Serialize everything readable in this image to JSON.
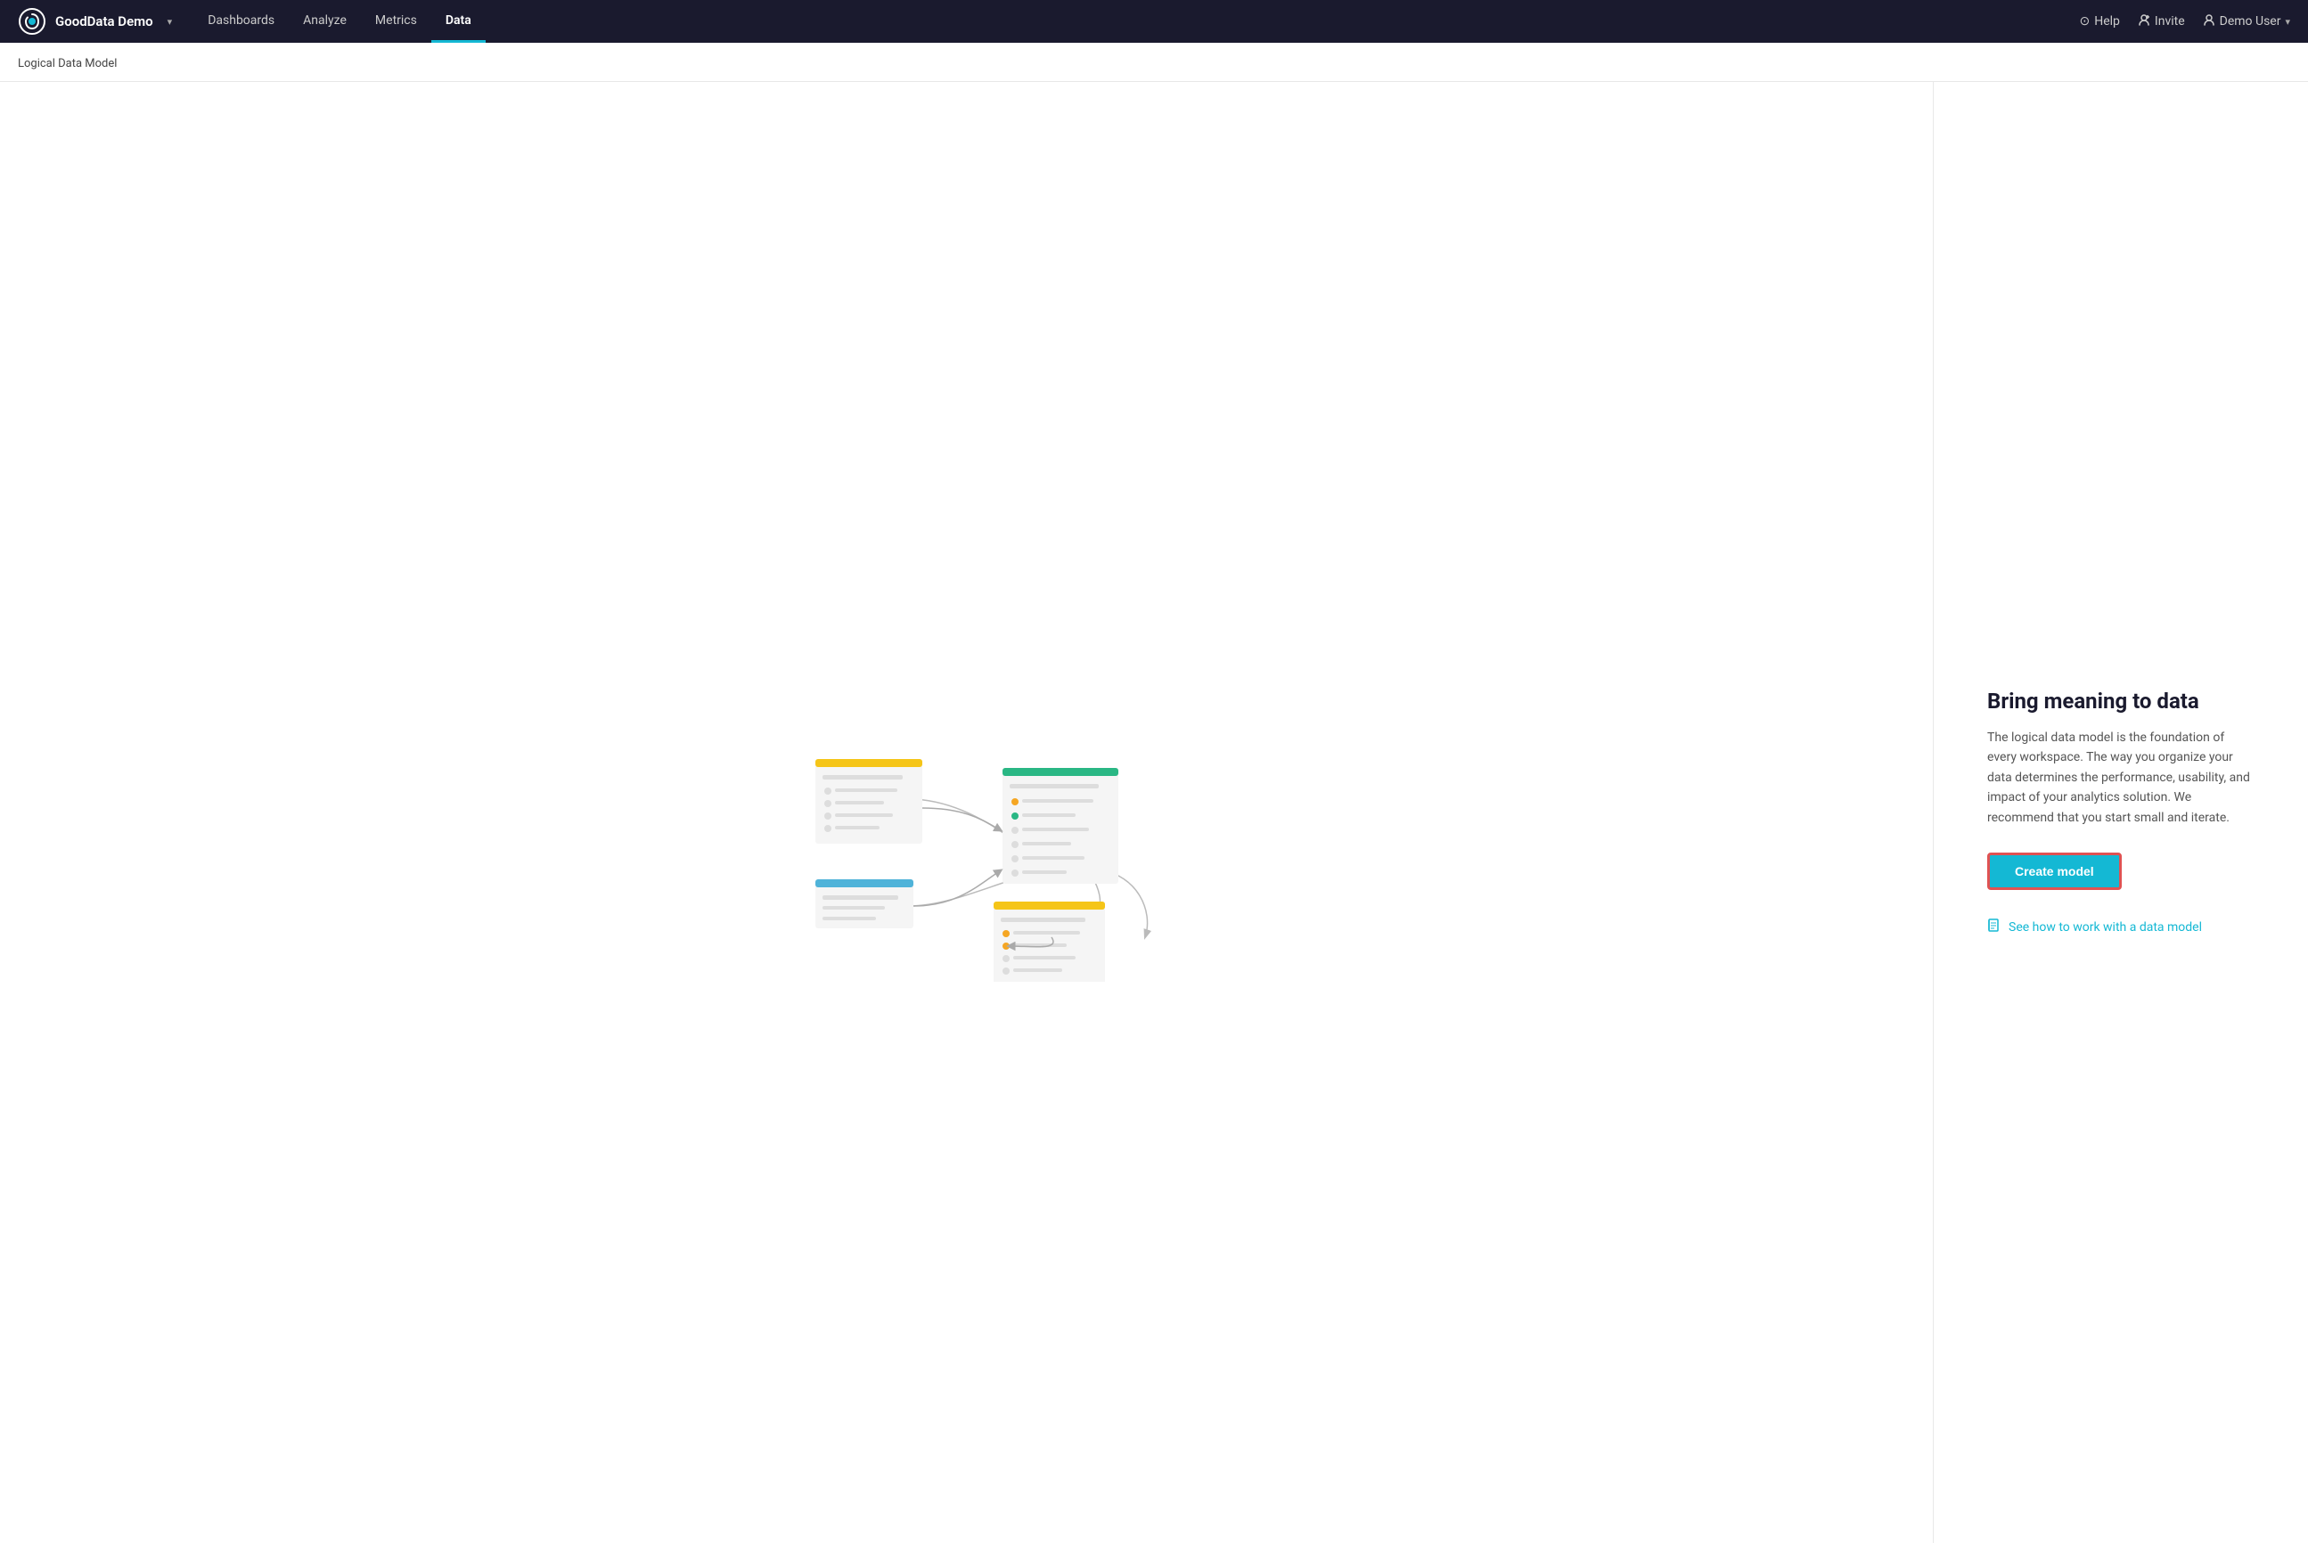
{
  "header": {
    "brand": "GoodData Demo",
    "dropdown_icon": "▾",
    "nav_items": [
      {
        "label": "Dashboards",
        "active": false
      },
      {
        "label": "Analyze",
        "active": false
      },
      {
        "label": "Metrics",
        "active": false
      },
      {
        "label": "Data",
        "active": true
      }
    ],
    "actions": [
      {
        "label": "Help",
        "icon": "?"
      },
      {
        "label": "Invite",
        "icon": "👤"
      },
      {
        "label": "Demo User",
        "icon": "👤",
        "has_dropdown": true
      }
    ]
  },
  "breadcrumb": "Logical Data Model",
  "main": {
    "title": "Bring meaning to data",
    "description": "The logical data model is the foundation of every workspace. The way you organize your data determines the performance, usability, and impact of your analytics solution. We recommend that you start small and iterate.",
    "create_button": "Create model",
    "help_link": "See how to work with a data model"
  },
  "colors": {
    "accent": "#14b8d4",
    "nav_active": "#14b8d4",
    "header_bg": "#1a1a2e",
    "card_yellow": "#f5c518",
    "card_green": "#2ab784",
    "card_blue": "#4fb3d9",
    "button_border": "#e05252"
  }
}
